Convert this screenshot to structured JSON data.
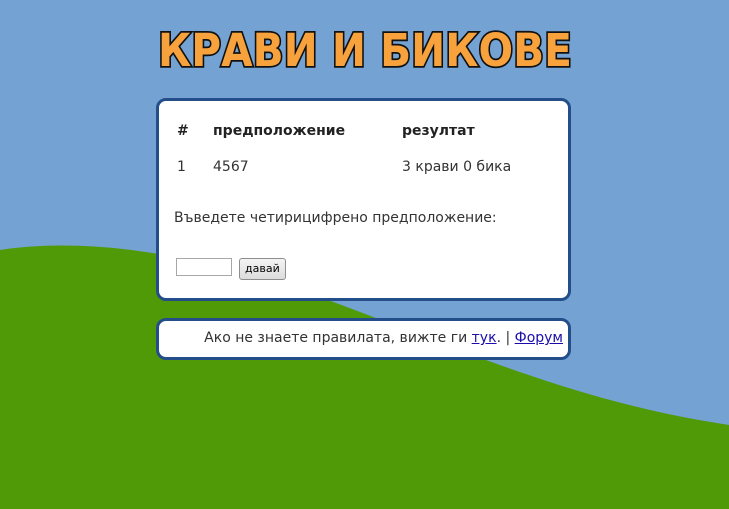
{
  "header": {
    "title": "КРАВИ И БИКОВЕ"
  },
  "game": {
    "columns": {
      "number": "#",
      "guess": "предположение",
      "result": "резултат"
    },
    "rows": [
      {
        "number": "1",
        "guess": "4567",
        "result": "3 крави 0 бика"
      }
    ],
    "prompt": "Въведете четирицифрено предположение:",
    "input": {
      "value": "",
      "placeholder": ""
    },
    "submit_label": "давай"
  },
  "footer": {
    "text_before": "Ако не знаете правилата, вижте ги ",
    "rules_link": "тук",
    "text_after": ". | ",
    "forum_link": "Форум"
  },
  "colors": {
    "sky": "#73a2d3",
    "hill": "#4f9a06",
    "panel_border": "#244e8a",
    "title_fill": "#f7a23c",
    "title_stroke": "#111111"
  }
}
